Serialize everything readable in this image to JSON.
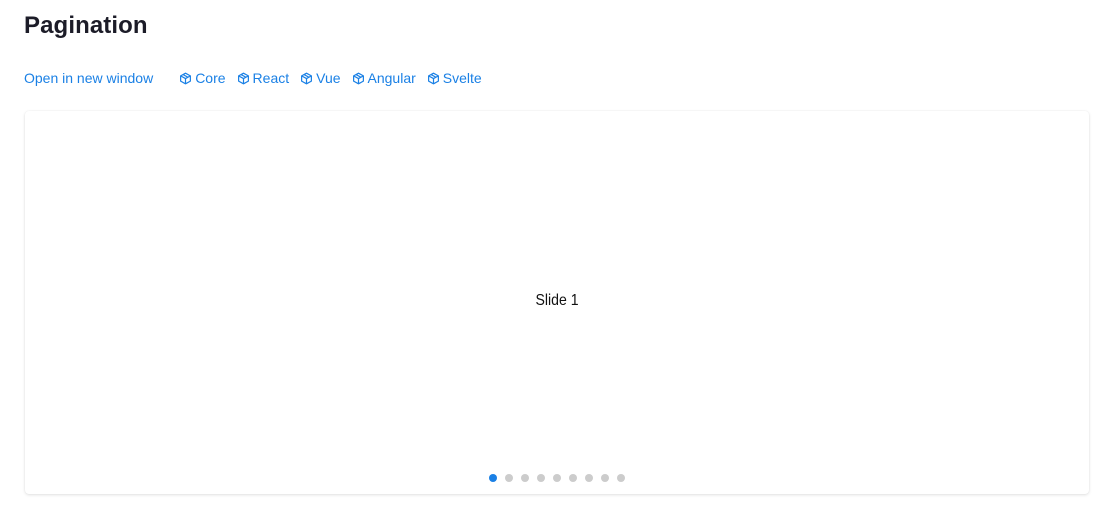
{
  "page": {
    "title": "Pagination"
  },
  "links": {
    "open_new_window": "Open in new window",
    "frameworks": [
      {
        "label": "Core",
        "icon": "cube-icon"
      },
      {
        "label": "React",
        "icon": "cube-icon"
      },
      {
        "label": "Vue",
        "icon": "cube-icon"
      },
      {
        "label": "Angular",
        "icon": "cube-icon"
      },
      {
        "label": "Svelte",
        "icon": "cube-icon"
      }
    ]
  },
  "demo": {
    "slide_label": "Slide 1",
    "pagination": {
      "total": 9,
      "active_index": 0
    }
  },
  "colors": {
    "accent": "#1a80e5",
    "bullet_inactive": "#cccccc",
    "title": "#1c1c28"
  }
}
